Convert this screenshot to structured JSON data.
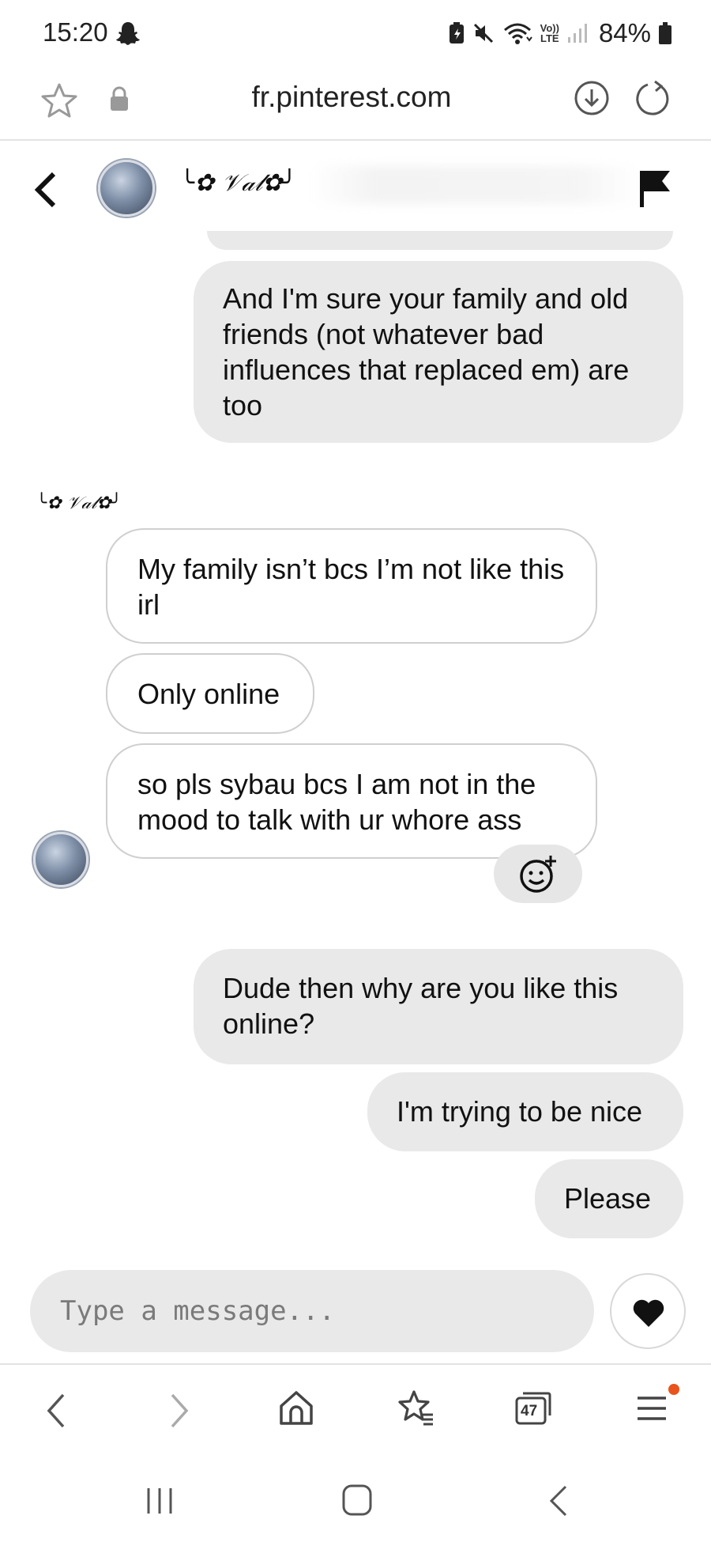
{
  "status_bar": {
    "time": "15:20",
    "volte_top": "Vo))",
    "volte_bottom": "LTE",
    "battery": "84%",
    "icons": [
      "snapchat-icon",
      "battery-saver-icon",
      "mute-icon",
      "wifi-icon",
      "volte-icon",
      "signal-icon",
      "battery-icon"
    ]
  },
  "browser": {
    "url": "fr.pinterest.com",
    "tabs_count": "47"
  },
  "chat": {
    "contact_name": "╰✿ 𝒱𝒶𝓁✿╯",
    "messages": [
      {
        "direction": "sent",
        "text": "And I'm sure your family and old friends (not whatever bad influences that replaced em) are too"
      },
      {
        "direction": "received",
        "text": "My family isn’t bcs I’m not like this irl"
      },
      {
        "direction": "received",
        "text": "Only online"
      },
      {
        "direction": "received",
        "text": "so pls sybau bcs I am not in the mood to talk with ur whore ass"
      },
      {
        "direction": "sent",
        "text": "Dude then why are you like this online?"
      },
      {
        "direction": "sent",
        "text": "I'm trying to be nice"
      },
      {
        "direction": "sent",
        "text": "Please"
      }
    ],
    "composer_placeholder": "Type a message..."
  },
  "colors": {
    "sent_bubble": "#e9e9e9",
    "received_border": "#cfcfcf",
    "badge": "#e8541c"
  }
}
